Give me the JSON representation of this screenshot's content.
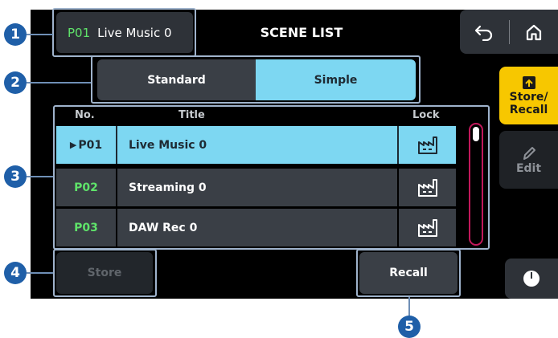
{
  "header": {
    "current_scene": {
      "number": "P01",
      "name": "Live Music 0"
    },
    "title": "SCENE LIST"
  },
  "top_buttons": [
    {
      "icon": "undo-icon"
    },
    {
      "icon": "home-icon"
    }
  ],
  "tabs": [
    {
      "label": "Standard",
      "selected": false
    },
    {
      "label": "Simple",
      "selected": true
    }
  ],
  "side_buttons": {
    "store_recall": {
      "label_line1": "Store/",
      "label_line2": "Recall",
      "icon": "store-recall-icon",
      "active": true
    },
    "edit": {
      "label": "Edit",
      "icon": "pencil-icon",
      "active": false
    }
  },
  "list": {
    "columns": {
      "no": "No.",
      "title": "Title",
      "lock": "Lock"
    },
    "rows": [
      {
        "no": "P01",
        "title": "Live Music 0",
        "selected": true,
        "marker": "▶"
      },
      {
        "no": "P02",
        "title": "Streaming 0",
        "selected": false,
        "marker": ""
      },
      {
        "no": "P03",
        "title": "DAW Rec 0",
        "selected": false,
        "marker": ""
      }
    ],
    "lock_icon": "factory-lock-icon"
  },
  "buttons": {
    "store": "Store",
    "recall": "Recall"
  },
  "callouts": [
    "1",
    "2",
    "3",
    "4",
    "5"
  ],
  "colors": {
    "accent_cyan": "#7dd7f2",
    "accent_yellow": "#f7c700",
    "scene_number_green": "#5fe36a",
    "callout_blue": "#1f5fa8",
    "scrollbar_magenta": "#c2185b"
  }
}
